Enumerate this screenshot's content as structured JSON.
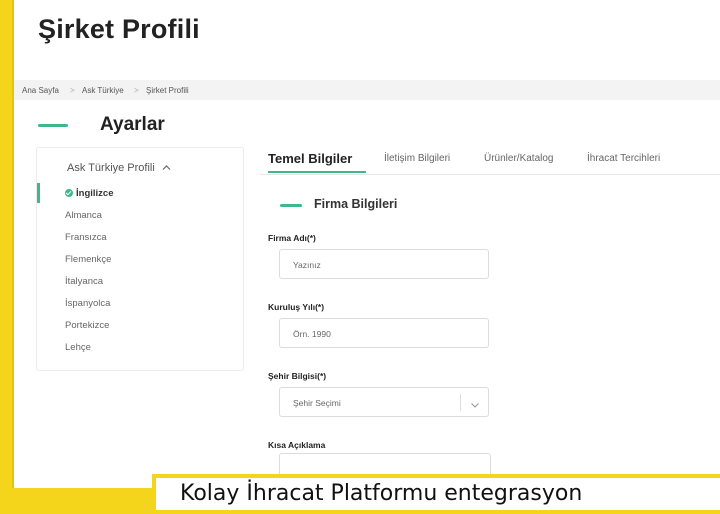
{
  "page": {
    "title": "Şirket Profili"
  },
  "breadcrumb": [
    "Ana Sayfa",
    "Ask Türkiye",
    "Şirket Profili"
  ],
  "settings": {
    "title": "Ayarlar"
  },
  "sidebar": {
    "profile_toggle": "Ask Türkiye Profili",
    "languages": [
      "İngilizce",
      "Almanca",
      "Fransızca",
      "Flemenkçe",
      "İtalyanca",
      "İspanyolca",
      "Portekizce",
      "Lehçe"
    ],
    "active_index": 0
  },
  "tabs": [
    "Temel Bilgiler",
    "İletişim Bilgileri",
    "Ürünler/Katalog",
    "İhracat Tercihleri"
  ],
  "section": {
    "title": "Firma Bilgileri"
  },
  "form": {
    "company_name_label": "Firma Adı(*)",
    "company_name_placeholder": "Yazınız",
    "founded_label": "Kuruluş Yılı(*)",
    "founded_placeholder": "Örn. 1990",
    "city_label": "Şehir Bilgisi(*)",
    "city_placeholder": "Şehir Seçimi",
    "short_desc_label": "Kısa Açıklama"
  },
  "caption": "Kolay İhracat Platformu entegrasyon",
  "colors": {
    "accent": "#3fb98a",
    "frame": "#f4d51c"
  }
}
